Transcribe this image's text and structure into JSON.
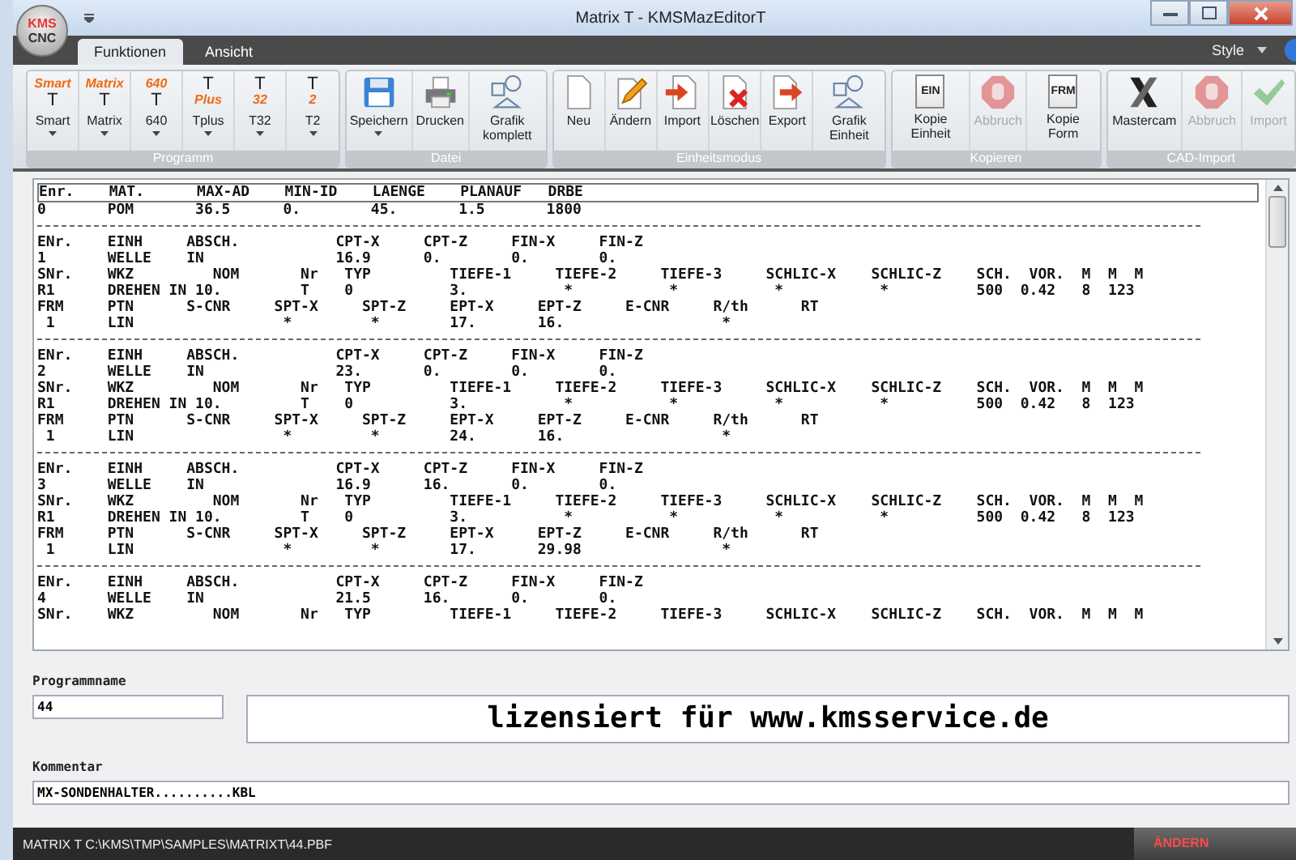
{
  "window": {
    "logo": [
      "KMS",
      "CNC"
    ],
    "title": "Matrix T - KMSMazEditorT"
  },
  "tabs": [
    {
      "label": "Funktionen",
      "selected": true
    },
    {
      "label": "Ansicht",
      "selected": false
    }
  ],
  "style_menu": "Style",
  "ribbon": [
    {
      "name": "Programm",
      "buttons": [
        {
          "kind": "mode",
          "label": "Smart",
          "icon_lines": [
            {
              "text": "Smart",
              "accent": true
            },
            {
              "text": "T",
              "accent": false
            }
          ],
          "has_menu": true,
          "disabled": false
        },
        {
          "kind": "mode",
          "label": "Matrix",
          "icon_lines": [
            {
              "text": "Matrix",
              "accent": true
            },
            {
              "text": "T",
              "accent": false
            }
          ],
          "has_menu": true,
          "disabled": false
        },
        {
          "kind": "mode",
          "label": "640",
          "icon_lines": [
            {
              "text": "640",
              "accent": true
            },
            {
              "text": "T",
              "accent": false
            }
          ],
          "has_menu": true,
          "disabled": false
        },
        {
          "kind": "mode",
          "label": "Tplus",
          "icon_lines": [
            {
              "text": "T",
              "accent": false
            },
            {
              "text": "Plus",
              "accent": true
            }
          ],
          "has_menu": true,
          "disabled": false
        },
        {
          "kind": "mode",
          "label": "T32",
          "icon_lines": [
            {
              "text": "T",
              "accent": false
            },
            {
              "text": "32",
              "accent": true
            }
          ],
          "has_menu": true,
          "disabled": false
        },
        {
          "kind": "mode",
          "label": "T2",
          "icon_lines": [
            {
              "text": "T",
              "accent": false
            },
            {
              "text": "2",
              "accent": true
            }
          ],
          "has_menu": true,
          "disabled": false
        }
      ]
    },
    {
      "name": "Datei",
      "buttons": [
        {
          "kind": "save",
          "label": "Speichern",
          "has_menu": true,
          "disabled": false
        },
        {
          "kind": "print",
          "label": "Drucken",
          "has_menu": false,
          "disabled": false
        },
        {
          "kind": "shapes",
          "label": "Grafik komplett",
          "has_menu": false,
          "disabled": false
        }
      ]
    },
    {
      "name": "Einheitsmodus",
      "buttons": [
        {
          "kind": "document",
          "label": "Neu",
          "has_menu": false,
          "disabled": false
        },
        {
          "kind": "edit",
          "label": "Ändern",
          "has_menu": false,
          "disabled": false
        },
        {
          "kind": "import",
          "label": "Import",
          "has_menu": false,
          "disabled": false
        },
        {
          "kind": "delete",
          "label": "Löschen",
          "has_menu": false,
          "disabled": false
        },
        {
          "kind": "export",
          "label": "Export",
          "has_menu": false,
          "disabled": false
        },
        {
          "kind": "shapes",
          "label": "Grafik Einheit",
          "has_menu": false,
          "disabled": false
        }
      ]
    },
    {
      "name": "Kopieren",
      "buttons": [
        {
          "kind": "copy",
          "label": "Kopie Einheit",
          "icon_text": "EIN",
          "has_menu": false,
          "disabled": false
        },
        {
          "kind": "stop",
          "label": "Abbruch",
          "has_menu": false,
          "disabled": true
        },
        {
          "kind": "copy",
          "label": "Kopie Form",
          "icon_text": "FRM",
          "has_menu": false,
          "disabled": false
        }
      ]
    },
    {
      "name": "CAD-Import",
      "buttons": [
        {
          "kind": "x-logo",
          "label": "Mastercam",
          "has_menu": false,
          "disabled": false
        },
        {
          "kind": "stop",
          "label": "Abbruch",
          "has_menu": false,
          "disabled": true
        },
        {
          "kind": "check",
          "label": "Import",
          "has_menu": false,
          "disabled": true
        }
      ]
    }
  ],
  "listing": [
    {
      "kind": "boxed",
      "text": "Enr.    MAT.      MAX-AD    MIN-ID    LAENGE    PLANAUF   DRBE"
    },
    {
      "kind": "text",
      "text": "0       POM       36.5      0.        45.       1.5       1800"
    },
    {
      "kind": "rule"
    },
    {
      "kind": "text",
      "text": "ENr.    EINH     ABSCH.           CPT-X     CPT-Z     FIN-X     FIN-Z"
    },
    {
      "kind": "text",
      "text": "1       WELLE    IN               16.9      0.        0.        0."
    },
    {
      "kind": "text",
      "text": "SNr.    WKZ         NOM       Nr   TYP         TIEFE-1     TIEFE-2     TIEFE-3     SCHLIC-X    SCHLIC-Z    SCH.  VOR.  M  M  M"
    },
    {
      "kind": "text",
      "text": "R1      DREHEN IN 10.         T    0           3.           *           *           *           *          500  0.42   8  123"
    },
    {
      "kind": "text",
      "text": "FRM     PTN      S-CNR     SPT-X     SPT-Z     EPT-X     EPT-Z     E-CNR     R/th      RT"
    },
    {
      "kind": "text",
      "text": " 1      LIN                 *         *        17.       16.                  *"
    },
    {
      "kind": "rule"
    },
    {
      "kind": "text",
      "text": "ENr.    EINH     ABSCH.           CPT-X     CPT-Z     FIN-X     FIN-Z"
    },
    {
      "kind": "text",
      "text": "2       WELLE    IN               23.       0.        0.        0."
    },
    {
      "kind": "text",
      "text": "SNr.    WKZ         NOM       Nr   TYP         TIEFE-1     TIEFE-2     TIEFE-3     SCHLIC-X    SCHLIC-Z    SCH.  VOR.  M  M  M"
    },
    {
      "kind": "text",
      "text": "R1      DREHEN IN 10.         T    0           3.           *           *           *           *          500  0.42   8  123"
    },
    {
      "kind": "text",
      "text": "FRM     PTN      S-CNR     SPT-X     SPT-Z     EPT-X     EPT-Z     E-CNR     R/th      RT"
    },
    {
      "kind": "text",
      "text": " 1      LIN                 *         *        24.       16.                  *"
    },
    {
      "kind": "rule"
    },
    {
      "kind": "text",
      "text": "ENr.    EINH     ABSCH.           CPT-X     CPT-Z     FIN-X     FIN-Z"
    },
    {
      "kind": "text",
      "text": "3       WELLE    IN               16.9      16.       0.        0."
    },
    {
      "kind": "text",
      "text": "SNr.    WKZ         NOM       Nr   TYP         TIEFE-1     TIEFE-2     TIEFE-3     SCHLIC-X    SCHLIC-Z    SCH.  VOR.  M  M  M"
    },
    {
      "kind": "text",
      "text": "R1      DREHEN IN 10.         T    0           3.           *           *           *           *          500  0.42   8  123"
    },
    {
      "kind": "text",
      "text": "FRM     PTN      S-CNR     SPT-X     SPT-Z     EPT-X     EPT-Z     E-CNR     R/th      RT"
    },
    {
      "kind": "text",
      "text": " 1      LIN                 *         *        17.       29.98                *"
    },
    {
      "kind": "rule"
    },
    {
      "kind": "text",
      "text": "ENr.    EINH     ABSCH.           CPT-X     CPT-Z     FIN-X     FIN-Z"
    },
    {
      "kind": "text",
      "text": "4       WELLE    IN               21.5      16.       0.        0."
    },
    {
      "kind": "text",
      "text": "SNr.    WKZ         NOM       Nr   TYP         TIEFE-1     TIEFE-2     TIEFE-3     SCHLIC-X    SCHLIC-Z    SCH.  VOR.  M  M  M"
    }
  ],
  "program_name": {
    "label": "Programmname",
    "value": "44"
  },
  "license": "lizensiert für www.kmsservice.de",
  "comment": {
    "label": "Kommentar",
    "value": "MX-SONDENHALTER..........KBL"
  },
  "status_bar": {
    "path": "MATRIX T C:\\KMS\\TMP\\SAMPLES\\MATRIXT\\44.PBF",
    "mode": "ÄNDERN"
  }
}
